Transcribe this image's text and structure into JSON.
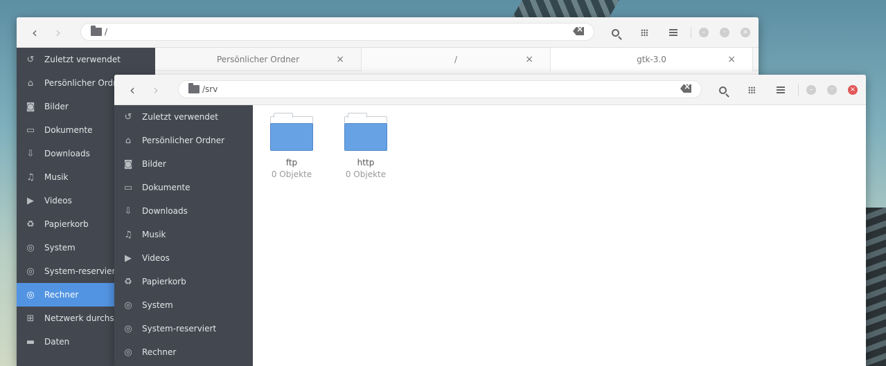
{
  "back_window": {
    "location": "/",
    "sidebar": [
      {
        "icon": "history-icon",
        "glyph": "↺",
        "label": "Zuletzt verwendet"
      },
      {
        "icon": "home-icon",
        "glyph": "⌂",
        "label": "Persönlicher Ordner"
      },
      {
        "icon": "camera-icon",
        "glyph": "◙",
        "label": "Bilder"
      },
      {
        "icon": "document-icon",
        "glyph": "▭",
        "label": "Dokumente"
      },
      {
        "icon": "download-icon",
        "glyph": "⇩",
        "label": "Downloads"
      },
      {
        "icon": "music-icon",
        "glyph": "♫",
        "label": "Musik"
      },
      {
        "icon": "video-icon",
        "glyph": "▶",
        "label": "Videos"
      },
      {
        "icon": "trash-icon",
        "glyph": "♻",
        "label": "Papierkorb"
      },
      {
        "icon": "drive-icon",
        "glyph": "◎",
        "label": "System"
      },
      {
        "icon": "drive-icon",
        "glyph": "◎",
        "label": "System-reserviert"
      },
      {
        "icon": "computer-icon",
        "glyph": "◎",
        "label": "Rechner",
        "active": true
      },
      {
        "icon": "network-icon",
        "glyph": "⊞",
        "label": "Netzwerk durchsuchen"
      },
      {
        "icon": "folder-icon",
        "glyph": "▬",
        "label": "Daten"
      }
    ],
    "tabs": [
      {
        "label": "Persönlicher Ordner",
        "close": "×"
      },
      {
        "label": "/",
        "close": "×"
      },
      {
        "label": "gtk-3.0",
        "close": "×"
      }
    ]
  },
  "front_window": {
    "location": "/srv",
    "sidebar": [
      {
        "icon": "history-icon",
        "glyph": "↺",
        "label": "Zuletzt verwendet"
      },
      {
        "icon": "home-icon",
        "glyph": "⌂",
        "label": "Persönlicher Ordner"
      },
      {
        "icon": "camera-icon",
        "glyph": "◙",
        "label": "Bilder"
      },
      {
        "icon": "document-icon",
        "glyph": "▭",
        "label": "Dokumente"
      },
      {
        "icon": "download-icon",
        "glyph": "⇩",
        "label": "Downloads"
      },
      {
        "icon": "music-icon",
        "glyph": "♫",
        "label": "Musik"
      },
      {
        "icon": "video-icon",
        "glyph": "▶",
        "label": "Videos"
      },
      {
        "icon": "trash-icon",
        "glyph": "♻",
        "label": "Papierkorb"
      },
      {
        "icon": "drive-icon",
        "glyph": "◎",
        "label": "System"
      },
      {
        "icon": "drive-icon",
        "glyph": "◎",
        "label": "System-reserviert"
      },
      {
        "icon": "computer-icon",
        "glyph": "◎",
        "label": "Rechner"
      }
    ],
    "files": [
      {
        "name": "ftp",
        "info": "0 Objekte"
      },
      {
        "name": "http",
        "info": "0 Objekte"
      }
    ]
  },
  "nav": {
    "back": "‹",
    "forward": "›"
  },
  "window_controls": {
    "minimize": "–",
    "maximize": "◦",
    "close": "×"
  },
  "colors": {
    "accent": "#5294e2",
    "sidebar_bg": "#434850",
    "close_red": "#e25757",
    "folder_blue": "#67a2e5"
  }
}
